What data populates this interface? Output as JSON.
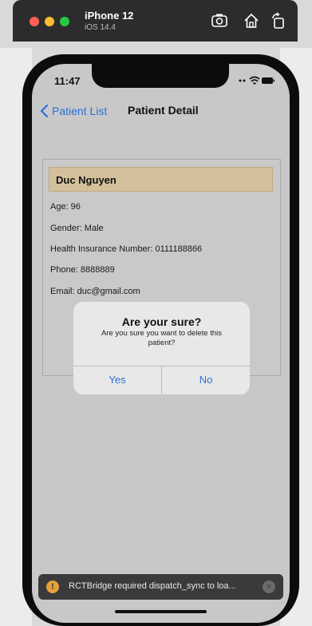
{
  "simulator": {
    "device_name": "iPhone 12",
    "os_version": "iOS 14.4"
  },
  "status_bar": {
    "time": "11:47"
  },
  "nav": {
    "back_label": "Patient List",
    "title": "Patient Detail"
  },
  "patient": {
    "name": "Duc Nguyen",
    "age": "Age: 96",
    "gender": "Gender: Male",
    "insurance": "Health Insurance Number: 0111188866",
    "phone": "Phone: 8888889",
    "email": "Email: duc@gmail.com"
  },
  "dialog": {
    "title": "Are your sure?",
    "message": "Are you sure you want to delete this patient?",
    "yes_label": "Yes",
    "no_label": "No"
  },
  "warning": {
    "icon": "!",
    "text": "RCTBridge required dispatch_sync to loa...",
    "close": "×"
  },
  "colors": {
    "accent": "#2f6fd4",
    "name_band": "#d4c19c",
    "toast_bg": "#3a3a3c"
  }
}
